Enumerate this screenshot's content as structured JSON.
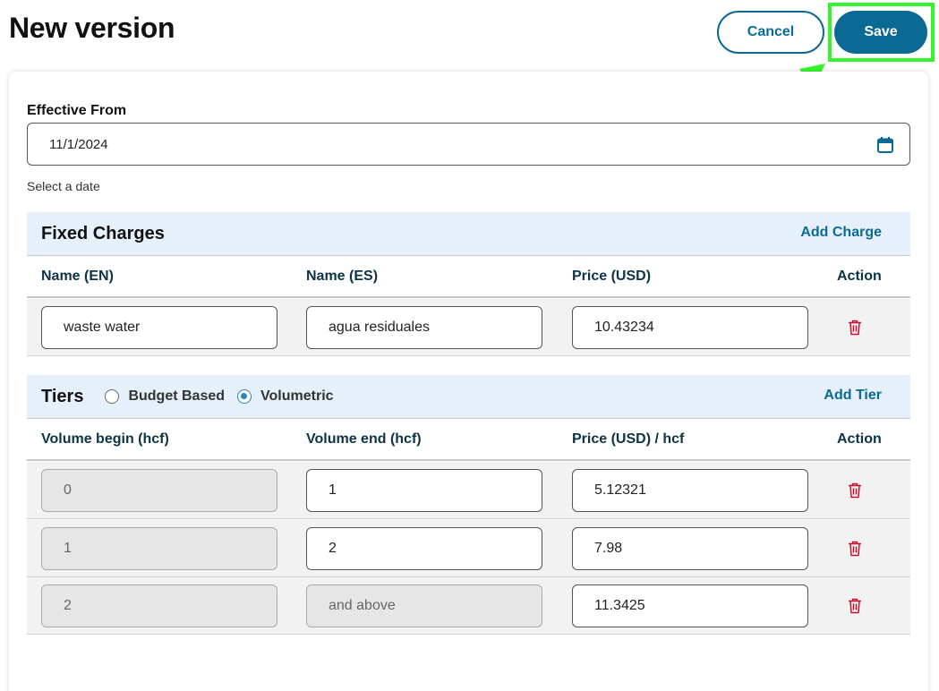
{
  "header": {
    "title": "New version",
    "cancel_label": "Cancel",
    "save_label": "Save"
  },
  "effective_from": {
    "label": "Effective From",
    "value": "11/1/2024",
    "helper": "Select a date",
    "icon": "calendar-icon"
  },
  "fixed_charges": {
    "title": "Fixed Charges",
    "add_label": "Add Charge",
    "columns": [
      "Name (EN)",
      "Name (ES)",
      "Price (USD)",
      "Action"
    ],
    "rows": [
      {
        "name_en": "waste water",
        "name_es": "agua residuales",
        "price": "10.43234"
      }
    ]
  },
  "tiers": {
    "title": "Tiers",
    "options": [
      "Budget Based",
      "Volumetric"
    ],
    "selected": "Volumetric",
    "add_label": "Add Tier",
    "columns": [
      "Volume begin (hcf)",
      "Volume end (hcf)",
      "Price (USD) / hcf",
      "Action"
    ],
    "rows": [
      {
        "begin": "0",
        "end": "1",
        "price": "5.12321"
      },
      {
        "begin": "1",
        "end": "2",
        "price": "7.98"
      },
      {
        "begin": "2",
        "end": "and above",
        "price": "11.3425"
      }
    ]
  },
  "colors": {
    "accent": "#0b6a93",
    "section_bg": "#e6f0fb",
    "delete": "#c8102e",
    "highlight": "#34f52b"
  }
}
